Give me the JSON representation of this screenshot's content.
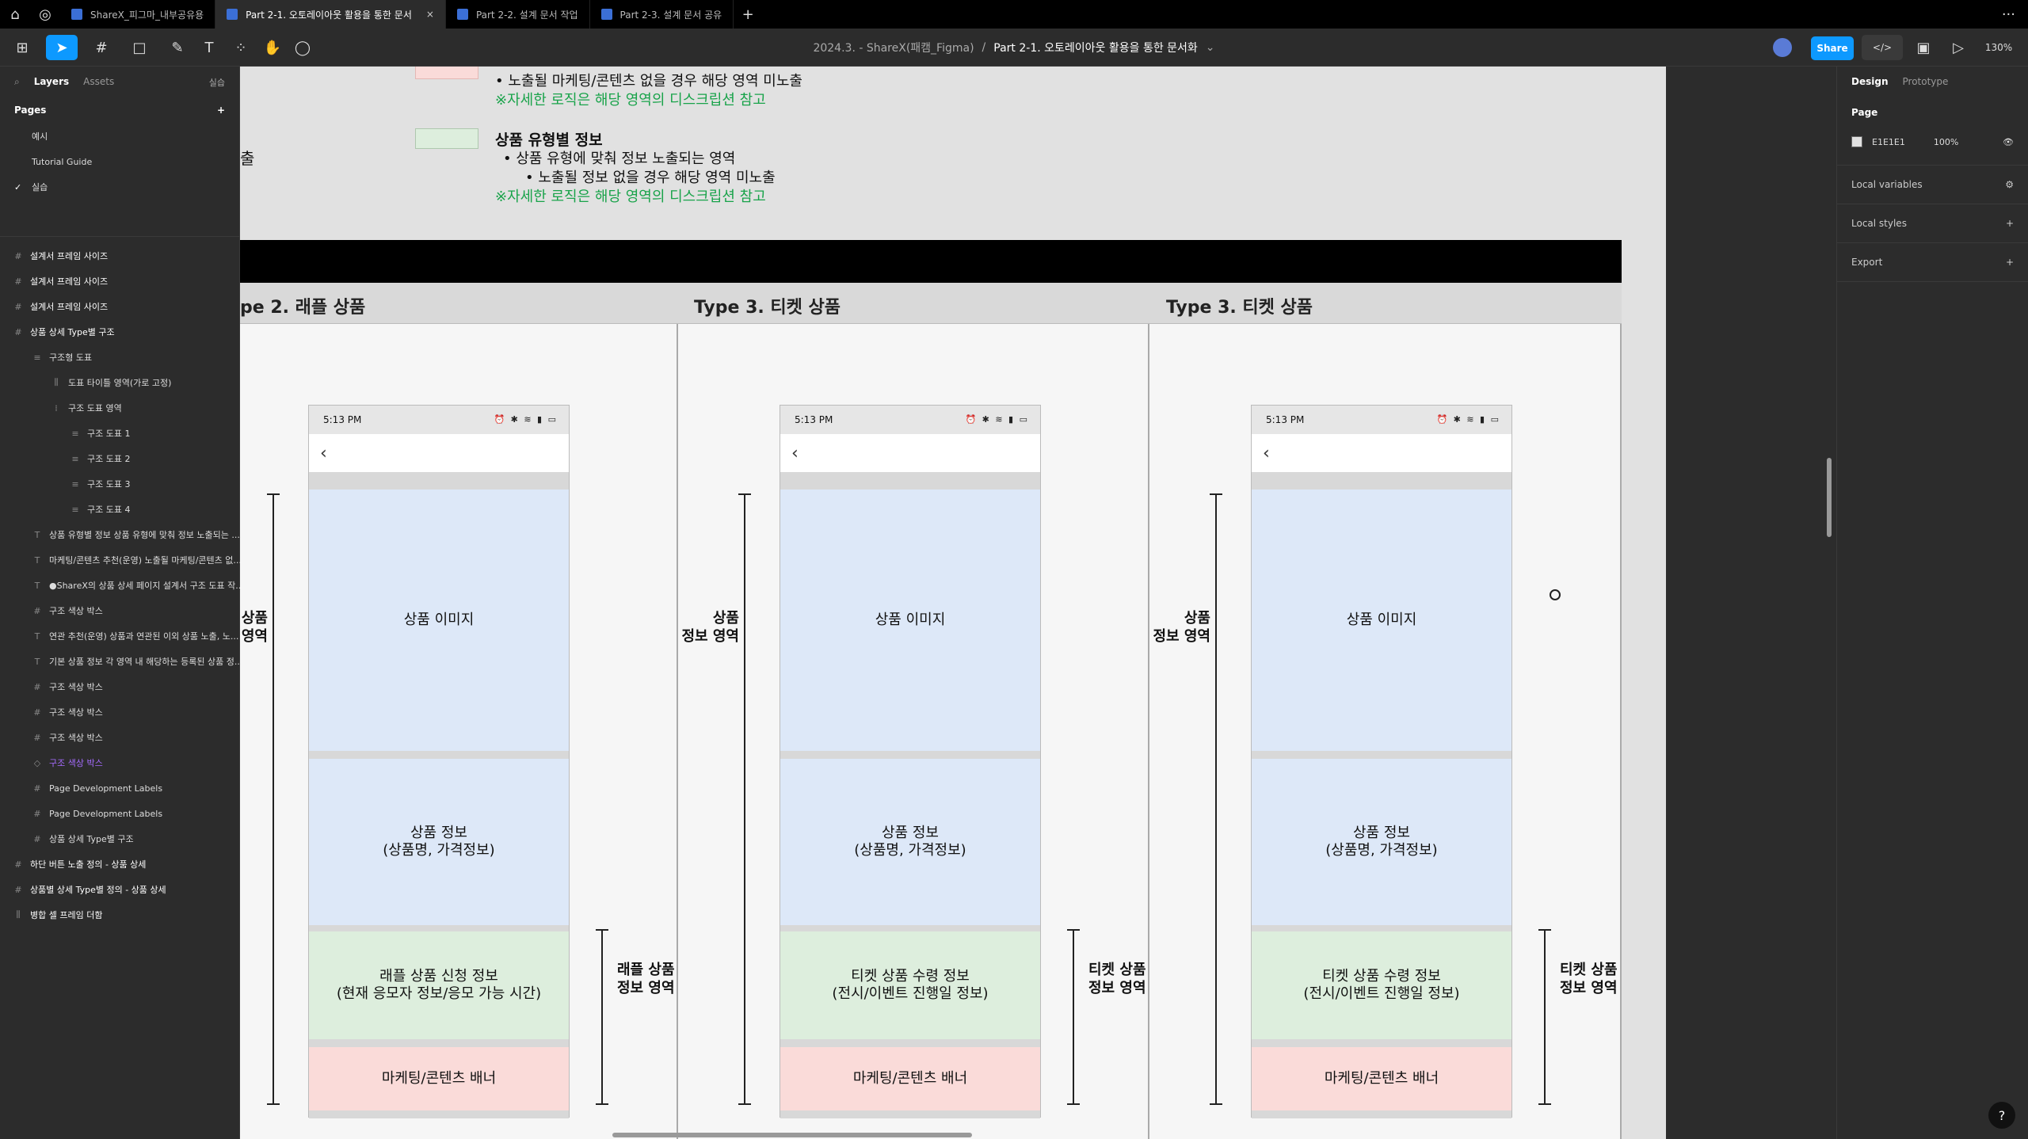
{
  "titlebar": {
    "tabs": [
      {
        "label": "ShareX_피그마_내부공유용",
        "active": false
      },
      {
        "label": "Part 2-1. 오토레이아웃 활용을 통한 문서",
        "active": true
      },
      {
        "label": "Part 2-2. 설계 문서 작업",
        "active": false
      },
      {
        "label": "Part 2-3. 설계 문서 공유",
        "active": false
      }
    ],
    "close": "×",
    "plus": "+",
    "more": "···"
  },
  "toolbar": {
    "file_path": "2024.3. - ShareX(패캠_Figma)",
    "separator": "/",
    "page_title": "Part 2-1. 오토레이아웃 활용을 통한 문서화",
    "share_label": "Share",
    "zoom": "130%",
    "code_icon": "</>"
  },
  "left_panel": {
    "tab_layers": "Layers",
    "tab_assets": "Assets",
    "current_page": "실습",
    "pages_title": "Pages",
    "add": "+",
    "pages": [
      "예시",
      "Tutorial Guide",
      "실습"
    ],
    "layers": [
      {
        "label": "설계서 프레임 사이즈",
        "indent": 0,
        "icon": "#"
      },
      {
        "label": "설계서 프레임 사이즈",
        "indent": 0,
        "icon": "#"
      },
      {
        "label": "설계서 프레임 사이즈",
        "indent": 0,
        "icon": "#"
      },
      {
        "label": "상품 상세 Type별 구조",
        "indent": 0,
        "icon": "#"
      },
      {
        "label": "구조형 도표",
        "indent": 1,
        "icon": "≡"
      },
      {
        "label": "도표 타이틀 영역(가로 고정)",
        "indent": 2,
        "icon": "⫼"
      },
      {
        "label": "구조 도표 영역",
        "indent": 2,
        "icon": "⁞"
      },
      {
        "label": "구조 도표 1",
        "indent": 3,
        "icon": "≡"
      },
      {
        "label": "구조 도표 2",
        "indent": 3,
        "icon": "≡"
      },
      {
        "label": "구조 도표 3",
        "indent": 3,
        "icon": "≡"
      },
      {
        "label": "구조 도표 4",
        "indent": 3,
        "icon": "≡"
      },
      {
        "label": "상품 유형별 정보 상품 유형에 맞춰 정보 노출되는 ...",
        "indent": 1,
        "icon": "T"
      },
      {
        "label": "마케팅/콘텐츠 추천(운영) 노출될 마케팅/콘텐츠 없...",
        "indent": 1,
        "icon": "T"
      },
      {
        "label": "●ShareX의 상품 상세 페이지 설계서 구조 도표 작...",
        "indent": 1,
        "icon": "T"
      },
      {
        "label": "구조 색상 박스",
        "indent": 1,
        "icon": "#"
      },
      {
        "label": "연관 추천(운영) 상품과 연관된 이외 상품 노출, 노...",
        "indent": 1,
        "icon": "T"
      },
      {
        "label": "기본 상품 정보 각 영역 내 해당하는 등록된 상품 정...",
        "indent": 1,
        "icon": "T"
      },
      {
        "label": "구조 색상 박스",
        "indent": 1,
        "icon": "#"
      },
      {
        "label": "구조 색상 박스",
        "indent": 1,
        "icon": "#"
      },
      {
        "label": "구조 색상 박스",
        "indent": 1,
        "icon": "#"
      },
      {
        "label": "구조 색상 박스",
        "indent": 1,
        "icon": "◇"
      },
      {
        "label": "Page Development Labels",
        "indent": 1,
        "icon": "#"
      },
      {
        "label": "Page Development Labels",
        "indent": 1,
        "icon": "#"
      },
      {
        "label": "상품 상세 Type별 구조",
        "indent": 1,
        "icon": "#"
      },
      {
        "label": "하단 버튼 노출 정의 - 상품 상세",
        "indent": 0,
        "icon": "#"
      },
      {
        "label": "상품별 상세 Type별 정의 - 상품 상세",
        "indent": 0,
        "icon": "#"
      },
      {
        "label": "병합 셀 프레임 더함",
        "indent": 0,
        "icon": "⫼"
      }
    ]
  },
  "canvas": {
    "legend": {
      "top_line1": "노출될 마케팅/콘텐츠 없을 경우 해당 영역 미노출",
      "top_note": "※자세한 로직은 해당 영역의 디스크립션 참고",
      "left_cut": "출",
      "green_title": "상품 유형별 정보",
      "green_bullet1": "상품 유형에 맞춰 정보 노출되는 영역",
      "green_bullet2": "노출될 정보 없을 경우 해당 영역 미노출",
      "green_note": "※자세한 로직은 해당 영역의 디스크립션 참고"
    },
    "columns": [
      {
        "type_label": "pe 2. 래플 상품",
        "side_label_top": "상품\n·영역",
        "status_time": "5:13 PM",
        "blocks": {
          "image": "상품 이미지",
          "info": "상품 정보\n(상품명, 가격정보)",
          "type_info": "래플 상품 신청 정보\n(현재 응모자 정보/응모 가능 시간)",
          "banner": "마케팅/콘텐츠 배너"
        },
        "right_label": "래플 상품\n정보 영역"
      },
      {
        "type_label": "Type 3. 티켓 상품",
        "side_label_top": "상품\n정보 영역",
        "status_time": "5:13 PM",
        "blocks": {
          "image": "상품 이미지",
          "info": "상품 정보\n(상품명, 가격정보)",
          "type_info": "티켓 상품 수령 정보\n(전시/이벤트 진행일 정보)",
          "banner": "마케팅/콘텐츠 배너"
        },
        "right_label": "티켓 상품\n정보 영역"
      },
      {
        "type_label": "Type 3. 티켓 상품",
        "side_label_top": "상품\n정보 영역",
        "status_time": "5:13 PM",
        "blocks": {
          "image": "상품 이미지",
          "info": "상품 정보\n(상품명, 가격정보)",
          "type_info": "티켓 상품 수령 정보\n(전시/이벤트 진행일 정보)",
          "banner": "마케팅/콘텐츠 배너"
        },
        "right_label": "티켓 상품\n정보 영역"
      }
    ]
  },
  "right_panel": {
    "tab_design": "Design",
    "tab_prototype": "Prototype",
    "page_heading": "Page",
    "page_color": "E1E1E1",
    "page_opacity": "100%",
    "local_variables": "Local variables",
    "local_styles": "Local styles",
    "export": "Export",
    "add": "+"
  },
  "help": "?"
}
